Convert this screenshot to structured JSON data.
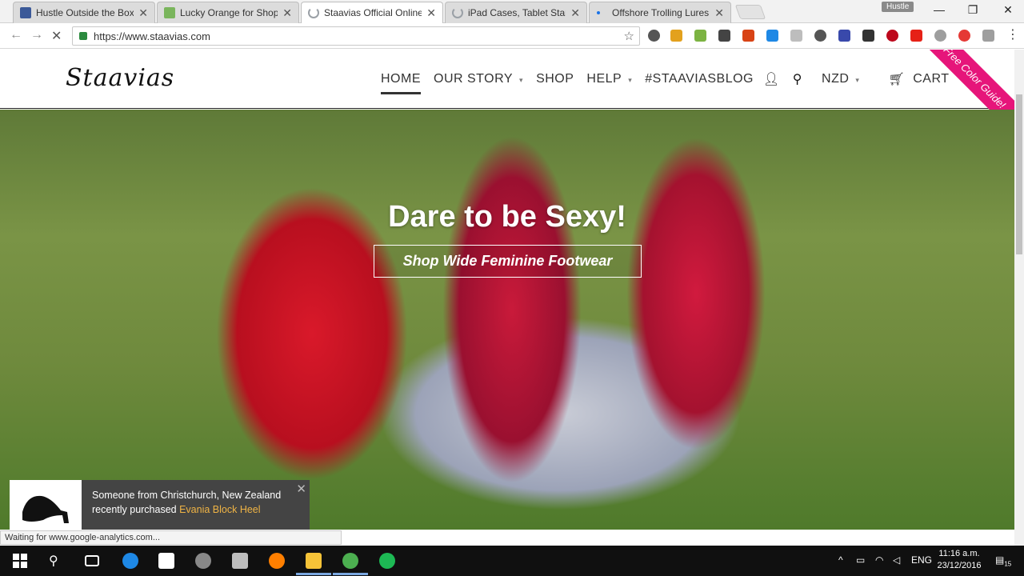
{
  "browser": {
    "tabs": [
      {
        "title": "Hustle Outside the Box-",
        "color": "#3b5998",
        "active": false
      },
      {
        "title": "Lucky Orange for Shopify",
        "color": "#7ab55c",
        "active": false
      },
      {
        "title": "Staavias Official Online B",
        "color": "#9aa0a6",
        "active": true
      },
      {
        "title": "iPad Cases, Tablet Stands",
        "color": "#9aa0a6",
        "active": false
      },
      {
        "title": "Offshore Trolling Lures fo",
        "color": "#1a73e8",
        "active": false
      }
    ],
    "profile": "Hustle",
    "url": "https://www.staavias.com"
  },
  "site": {
    "logo": "Staavias",
    "nav": {
      "home": "HOME",
      "our_story": "OUR STORY",
      "shop": "SHOP",
      "help": "HELP",
      "blog": "#STAAVIASBLOG",
      "currency": "NZD",
      "cart": "CART"
    },
    "ribbon": "Free Color Guide!",
    "hero": {
      "title": "Dare to be Sexy!",
      "button": "Shop Wide Feminine Footwear"
    },
    "toast": {
      "line1": "Someone from Christchurch, New Zealand",
      "line2": "recently purchased ",
      "product": "Evania Block Heel"
    },
    "status": "Waiting for www.google-analytics.com..."
  },
  "taskbar": {
    "lang": "ENG",
    "time": "11:16 a.m.",
    "date": "23/12/2016",
    "notifications": "15"
  }
}
